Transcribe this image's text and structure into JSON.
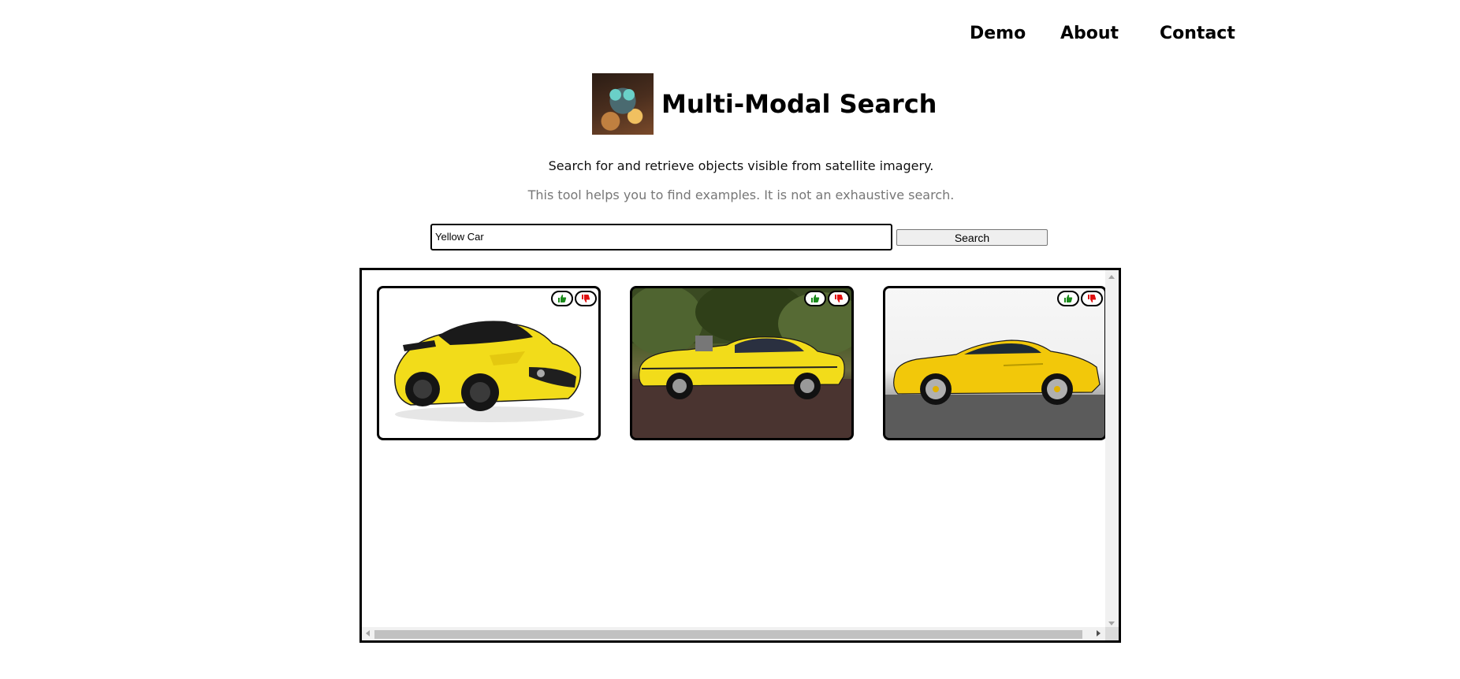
{
  "nav": {
    "items": [
      "Demo",
      "About",
      "Contact"
    ]
  },
  "header": {
    "title": "Multi-Modal Search"
  },
  "intro": {
    "line1": "Search for and retrieve objects visible from satellite imagery.",
    "line2": "This tool helps you to find examples. It is not an exhaustive search."
  },
  "search": {
    "value": "Yellow Car",
    "button_label": "Search"
  },
  "results": [
    {
      "name": "result-1"
    },
    {
      "name": "result-2"
    },
    {
      "name": "result-3"
    }
  ],
  "colors": {
    "accent_yellow": "#f2dc1a",
    "thumb_up": "#1a8a1a",
    "thumb_down": "#e01010"
  }
}
